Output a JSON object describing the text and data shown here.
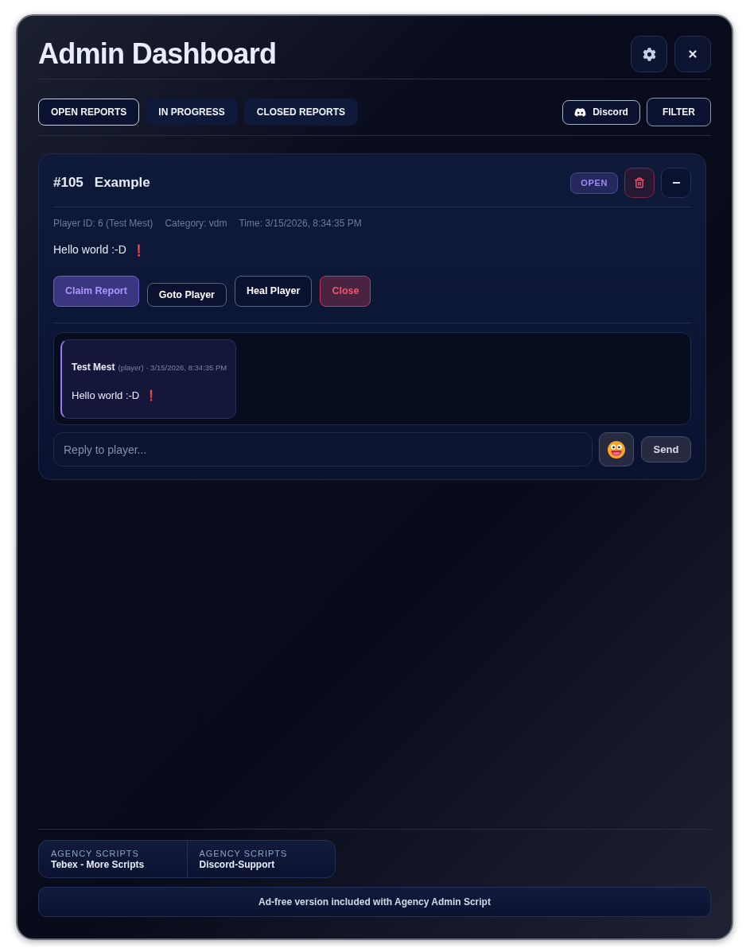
{
  "window": {
    "title": "Admin Dashboard"
  },
  "tabs": [
    {
      "label": "OPEN REPORTS",
      "selected": true
    },
    {
      "label": "IN PROGRESS",
      "selected": false
    },
    {
      "label": "CLOSED REPORTS",
      "selected": false
    }
  ],
  "toolbar": {
    "discord_button": "Discord",
    "filter_button": "FILTER"
  },
  "reports": [
    {
      "number": "#105",
      "title": "Example",
      "status": "OPEN",
      "expanded": true,
      "meta": [
        "Player ID: 6 (Test Mest)",
        "Category: vdm",
        "Time: 3/15/2026, 8:34:35 PM"
      ],
      "message": "Hello world :-D",
      "message_emoji": "❗",
      "actions": [
        {
          "label": "Claim Report",
          "kind": "accent"
        },
        {
          "label": "Goto Player",
          "kind": "compact"
        },
        {
          "label": "Heal Player",
          "kind": "outline"
        },
        {
          "label": "Close",
          "kind": "danger"
        }
      ],
      "chat": [
        {
          "author": "Test Mest",
          "details": "(player) · 3/15/2026, 8:34:35 PM",
          "text": "Hello world :-D",
          "emoji": "❗"
        }
      ],
      "reply": {
        "placeholder": "Reply to player..."
      },
      "send_button": "Send"
    }
  ],
  "footer": {
    "links": [
      {
        "label": "AGENCY SCRIPTS",
        "title": "Tebex - More Scripts"
      },
      {
        "label": "AGENCY SCRIPTS",
        "title": "Discord-Support"
      }
    ],
    "notice": "Ad-free version included with Agency Admin Script"
  }
}
